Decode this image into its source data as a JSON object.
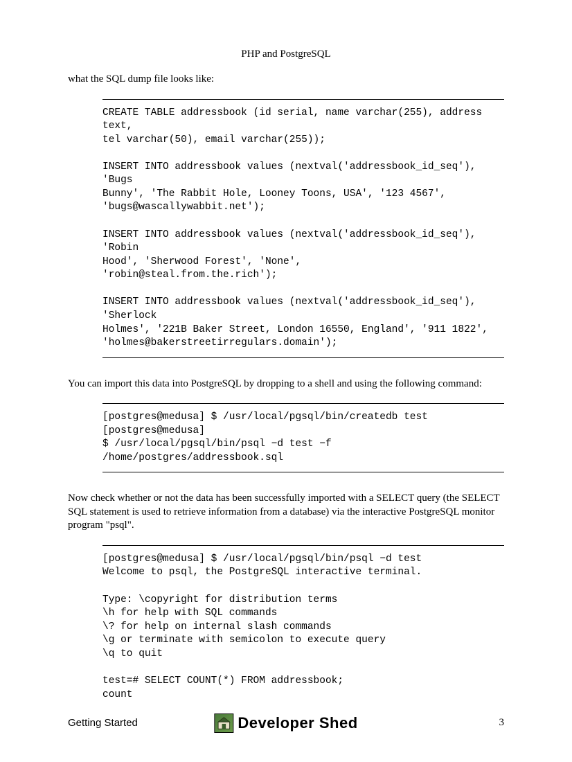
{
  "header": {
    "title": "PHP and PostgreSQL"
  },
  "para1": "what the SQL dump file looks like:",
  "code1": "CREATE TABLE addressbook (id serial, name varchar(255), address text,\ntel varchar(50), email varchar(255));\n\nINSERT INTO addressbook values (nextval('addressbook_id_seq'), 'Bugs\nBunny', 'The Rabbit Hole, Looney Toons, USA', '123 4567',\n'bugs@wascallywabbit.net');\n\nINSERT INTO addressbook values (nextval('addressbook_id_seq'), 'Robin\nHood', 'Sherwood Forest', 'None',\n'robin@steal.from.the.rich');\n\nINSERT INTO addressbook values (nextval('addressbook_id_seq'), 'Sherlock\nHolmes', '221B Baker Street, London 16550, England', '911 1822',\n'holmes@bakerstreetirregulars.domain');",
  "para2": "You can import this data into PostgreSQL by dropping to a shell and using the following command:",
  "code2": "[postgres@medusa] $ /usr/local/pgsql/bin/createdb test\n[postgres@medusa]\n$ /usr/local/pgsql/bin/psql −d test −f\n/home/postgres/addressbook.sql",
  "para3": "Now check whether or not the data has been successfully imported with a SELECT query (the SELECT SQL statement is used to retrieve information from a database) via the interactive PostgreSQL monitor program \"psql\".",
  "code3": "[postgres@medusa] $ /usr/local/pgsql/bin/psql −d test\nWelcome to psql, the PostgreSQL interactive terminal.\n\nType: \\copyright for distribution terms\n\\h for help with SQL commands\n\\? for help on internal slash commands\n\\g or terminate with semicolon to execute query\n\\q to quit\n\ntest=# SELECT COUNT(*) FROM addressbook;\ncount",
  "footer": {
    "section": "Getting Started",
    "brand": "Developer Shed",
    "page": "3"
  }
}
